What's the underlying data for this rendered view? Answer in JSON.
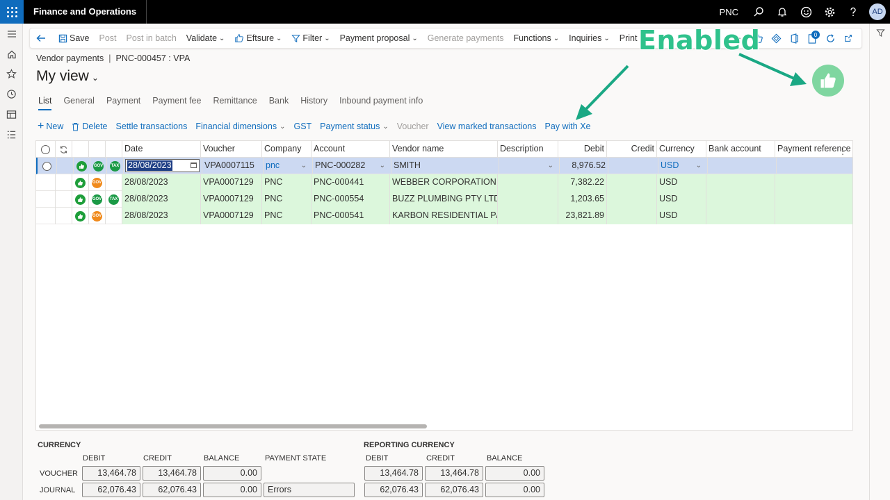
{
  "app": {
    "title": "Finance and Operations",
    "company": "PNC",
    "avatar": "AD"
  },
  "actionpane": {
    "save": "Save",
    "post": "Post",
    "post_in_batch": "Post in batch",
    "validate": "Validate",
    "eftsure": "Eftsure",
    "filter": "Filter",
    "payment_proposal": "Payment proposal",
    "generate_payments": "Generate payments",
    "functions": "Functions",
    "inquiries": "Inquiries",
    "print": "Print",
    "notification_count": "0"
  },
  "header": {
    "breadcrumb_parent": "Vendor payments",
    "breadcrumb_current": "PNC-000457 : VPA",
    "view_title": "My view"
  },
  "tabs": [
    "List",
    "General",
    "Payment",
    "Payment fee",
    "Remittance",
    "Bank",
    "History",
    "Inbound payment info"
  ],
  "gridbar": {
    "new": "New",
    "delete": "Delete",
    "settle": "Settle transactions",
    "fin_dims": "Financial dimensions",
    "gst": "GST",
    "payment_status": "Payment status",
    "voucher": "Voucher",
    "view_marked": "View marked transactions",
    "pay_with_xe": "Pay with Xe"
  },
  "grid": {
    "columns": {
      "date": "Date",
      "voucher": "Voucher",
      "company": "Company",
      "account": "Account",
      "vendor": "Vendor name",
      "description": "Description",
      "debit": "Debit",
      "credit": "Credit",
      "currency": "Currency",
      "bank": "Bank account",
      "payref": "Payment reference"
    },
    "rows": [
      {
        "date": "28/08/2023",
        "voucher": "VPA0007115",
        "company": "pnc",
        "account": "PNC-000282",
        "vendor": "SMITH",
        "description": "",
        "debit": "8,976.52",
        "credit": "",
        "currency": "USD",
        "bank": "",
        "payref": "",
        "icons": [
          "green-thumb",
          "gov-green",
          "tax"
        ]
      },
      {
        "date": "28/08/2023",
        "voucher": "VPA0007129",
        "company": "PNC",
        "account": "PNC-000441",
        "vendor": "WEBBER CORPORATION P...",
        "description": "",
        "debit": "7,382.22",
        "credit": "",
        "currency": "USD",
        "bank": "",
        "payref": "",
        "icons": [
          "green-thumb",
          "gov-orange"
        ]
      },
      {
        "date": "28/08/2023",
        "voucher": "VPA0007129",
        "company": "PNC",
        "account": "PNC-000554",
        "vendor": "BUZZ PLUMBING PTY LTD",
        "description": "",
        "debit": "1,203.65",
        "credit": "",
        "currency": "USD",
        "bank": "",
        "payref": "",
        "icons": [
          "green-thumb",
          "gov-green",
          "tax"
        ]
      },
      {
        "date": "28/08/2023",
        "voucher": "VPA0007129",
        "company": "PNC",
        "account": "PNC-000541",
        "vendor": "KARBON RESIDENTIAL P/L",
        "description": "",
        "debit": "23,821.89",
        "credit": "",
        "currency": "USD",
        "bank": "",
        "payref": "",
        "icons": [
          "green-thumb",
          "gov-orange"
        ]
      }
    ]
  },
  "summary": {
    "currency_title": "CURRENCY",
    "reporting_title": "REPORTING CURRENCY",
    "debit_label": "DEBIT",
    "credit_label": "CREDIT",
    "balance_label": "BALANCE",
    "payment_state_label": "PAYMENT STATE",
    "voucher_label": "VOUCHER",
    "journal_label": "JOURNAL",
    "voucher": {
      "debit": "13,464.78",
      "credit": "13,464.78",
      "balance": "0.00"
    },
    "journal": {
      "debit": "62,076.43",
      "credit": "62,076.43",
      "balance": "0.00",
      "payment_state": "Errors"
    },
    "rep_voucher": {
      "debit": "13,464.78",
      "credit": "13,464.78",
      "balance": "0.00"
    },
    "rep_journal": {
      "debit": "62,076.43",
      "credit": "62,076.43",
      "balance": "0.00"
    }
  },
  "annotation": {
    "text": "Enabled",
    "color": "#2fc28c"
  },
  "colors": {
    "accent": "#0f6cbd",
    "valid_row": "#dcf7dc",
    "selected_row": "#ccd9f2",
    "gov_ok": "#1e9e3a",
    "gov_warn": "#f08a1c"
  }
}
